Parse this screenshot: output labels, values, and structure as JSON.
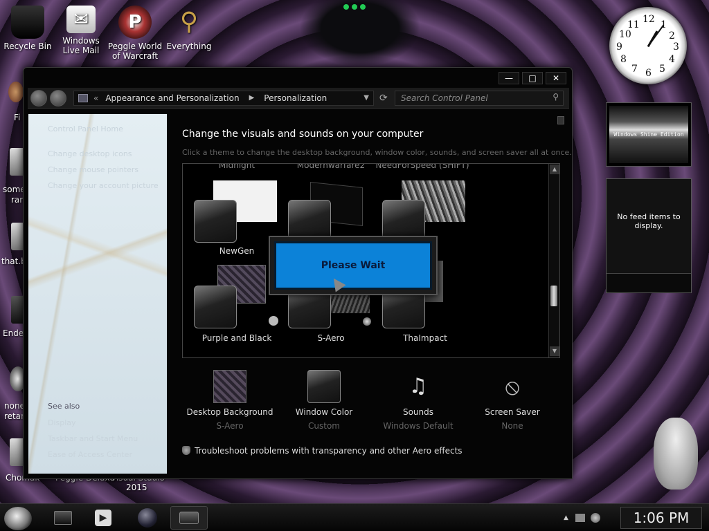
{
  "desktop": {
    "icons": [
      {
        "label": "Recycle Bin",
        "icon": "recycle-bin-icon"
      },
      {
        "label": "Windows Live Mail",
        "icon": "mail-icon"
      },
      {
        "label": "Peggle World of Warcraft ...",
        "icon": "peggle-icon"
      },
      {
        "label": "Everything",
        "icon": "search-icon"
      }
    ],
    "edge_labels": [
      "Fi",
      "some",
      "ran",
      "that.b",
      "Ender",
      "none",
      "retarc",
      "Chomak",
      "Peggle Deluxe",
      "Visual Studio",
      "2015"
    ]
  },
  "window": {
    "controls": {
      "minimize": "—",
      "maximize": "□",
      "close": "✕"
    },
    "breadcrumb": [
      "Appearance and Personalization",
      "Personalization"
    ],
    "breadcrumb_sep": "▶",
    "search": {
      "placeholder": "Search Control Panel"
    },
    "left_pane": {
      "links": [
        "Control Panel Home",
        "Change desktop icons",
        "Change mouse pointers",
        "Change your account picture"
      ],
      "see_also_title": "See also",
      "see_also": [
        "Display",
        "Taskbar and Start Menu",
        "Ease of Access Center"
      ]
    },
    "main": {
      "title": "Change the visuals and sounds on your computer",
      "subtitle": "Click a theme to change the desktop background, window color, sounds, and screen saver all at once.",
      "top_labels": [
        "Midnight",
        "Modernwarfare2",
        "NeedForSpeed (SHIFT)"
      ],
      "themes": [
        "NewGen",
        "Purple and Black",
        "S-Aero",
        "ThaImpact"
      ],
      "please_wait": "Please Wait"
    },
    "bottom": [
      {
        "title": "Desktop Background",
        "value": "S-Aero"
      },
      {
        "title": "Window Color",
        "value": "Custom"
      },
      {
        "title": "Sounds",
        "value": "Windows Default"
      },
      {
        "title": "Screen Saver",
        "value": "None"
      }
    ],
    "troubleshoot": "Troubleshoot problems with transparency and other Aero effects"
  },
  "gadgets": {
    "banner": "Windows Shine Edition",
    "feed": "No feed items to display.",
    "clock_numbers": [
      "12",
      "1",
      "2",
      "3",
      "4",
      "5",
      "6",
      "7",
      "8",
      "9",
      "10",
      "11"
    ]
  },
  "taskbar": {
    "time": "1:06 PM"
  },
  "colors": {
    "accent": "#0c82d8",
    "window_bg": "#050505"
  }
}
